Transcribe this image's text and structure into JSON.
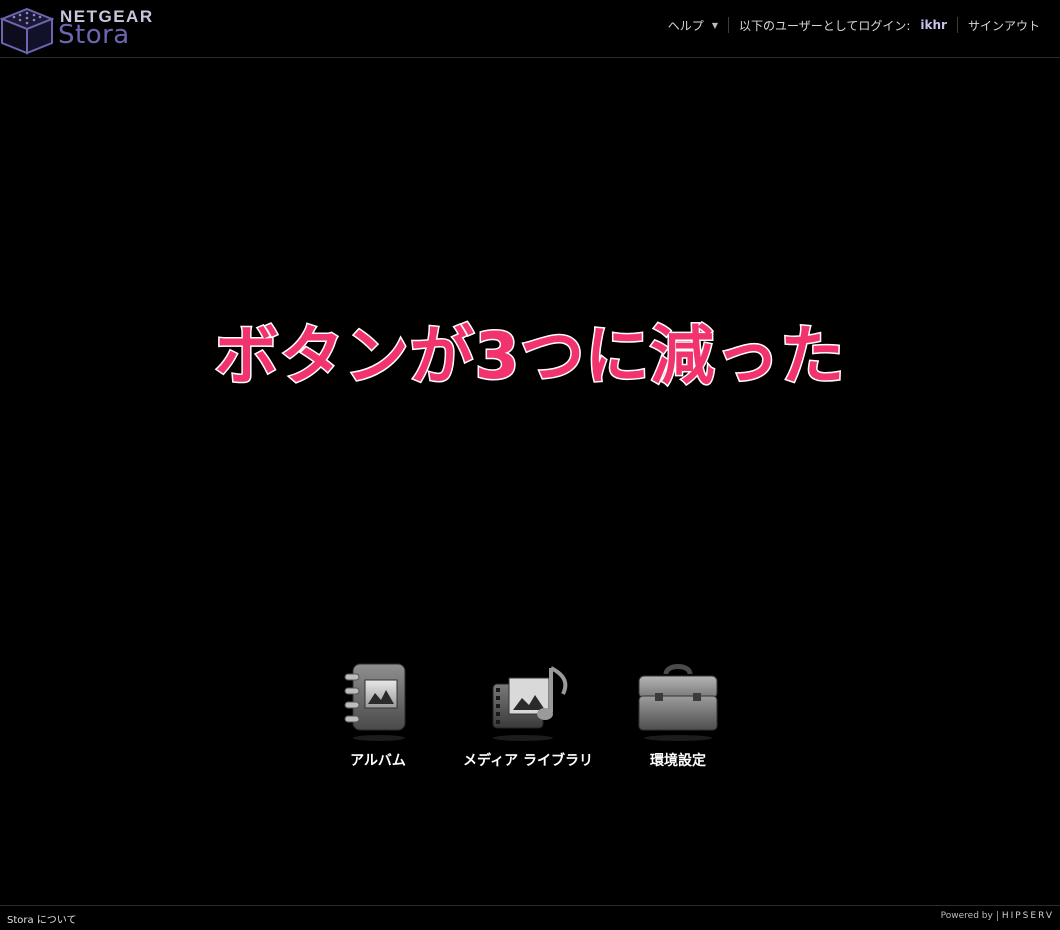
{
  "header": {
    "brand": "NETGEAR",
    "product": "Stora",
    "help_label": "ヘルプ",
    "login_prefix": "以下のユーザーとしてログイン:",
    "username": "ikhr",
    "signout_label": "サインアウト"
  },
  "caption": "ボタンが3つに減った",
  "apps": [
    {
      "label": "アルバム",
      "icon": "album-icon"
    },
    {
      "label": "メディア ライブラリ",
      "icon": "media-library-icon"
    },
    {
      "label": "環境設定",
      "icon": "toolbox-icon"
    }
  ],
  "footer": {
    "about_label": "Stora について",
    "powered_by": "Powered by",
    "hipserv": "HIPSERV"
  },
  "colors": {
    "background": "#000000",
    "caption": "#f2346e",
    "product_logo": "#6c66b0"
  }
}
